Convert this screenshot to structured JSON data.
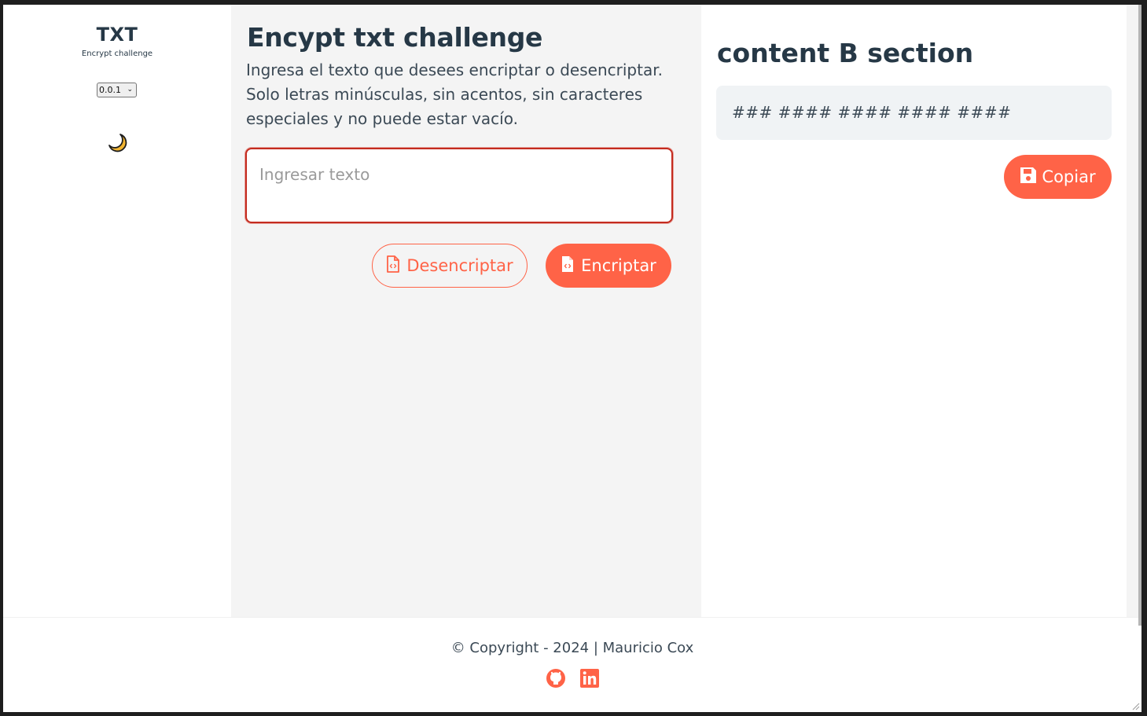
{
  "sidebar": {
    "title": "TXT",
    "subtitle": "Encrypt challenge",
    "version": "0.0.1",
    "theme_icon": "moon-icon"
  },
  "content_a": {
    "title": "Encypt txt challenge",
    "instructions": "Ingresa el texto que desees encriptar o desencriptar. Solo letras minúsculas, sin acentos, sin caracteres especiales y no puede estar vacío.",
    "input_placeholder": "Ingresar texto",
    "input_value": "",
    "decrypt_label": "Desencriptar",
    "encrypt_label": "Encriptar",
    "file_icon": "file-code-icon"
  },
  "content_b": {
    "title": "content B section",
    "output": "### #### #### #### ####",
    "copy_label": "Copiar",
    "copy_icon": "save-icon"
  },
  "footer": {
    "copyright": "© Copyright - 2024 | Mauricio Cox",
    "social_icons": [
      "github-icon",
      "linkedin-icon"
    ]
  },
  "colors": {
    "accent": "#ff6347",
    "text_dark": "#263846",
    "panel_bg": "#f4f4f4",
    "output_bg": "#f0f3f5"
  }
}
